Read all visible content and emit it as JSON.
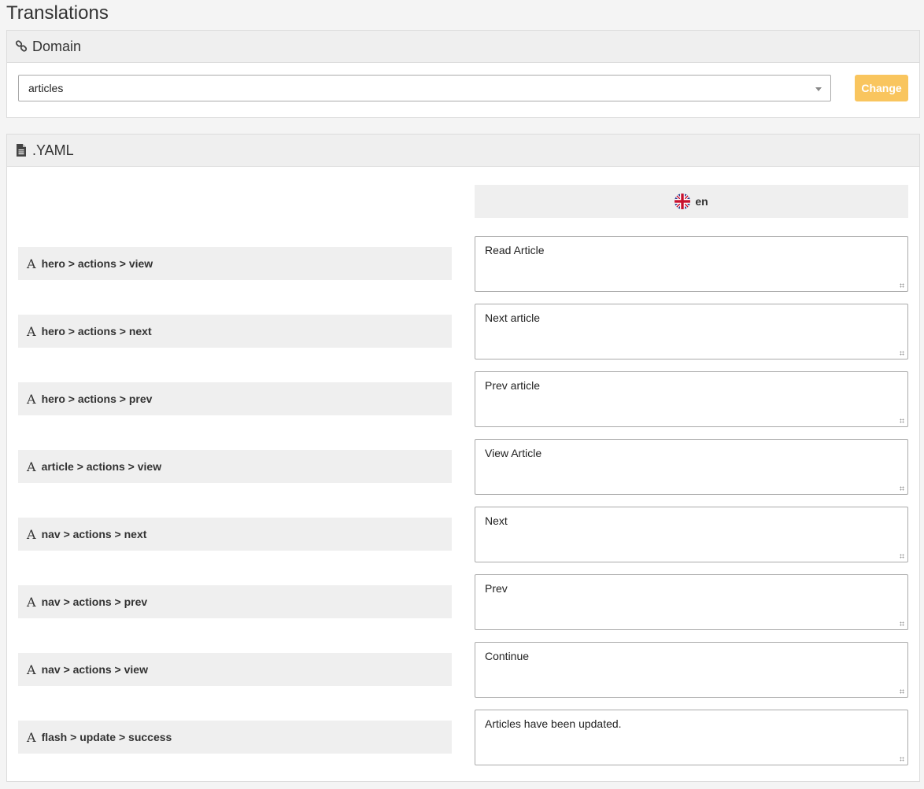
{
  "page": {
    "title": "Translations"
  },
  "domain_panel": {
    "heading": "Domain",
    "icon": "link-icon",
    "select_value": "articles",
    "change_label": "Change"
  },
  "yaml_panel": {
    "heading": ".YAML",
    "icon": "file-text-icon",
    "language": "en",
    "language_flag": "uk-flag-icon",
    "rows": [
      {
        "key": "hero > actions > view",
        "value": "Read Article"
      },
      {
        "key": "hero > actions > next",
        "value": "Next article"
      },
      {
        "key": "hero > actions > prev",
        "value": "Prev article"
      },
      {
        "key": "article > actions > view",
        "value": "View Article"
      },
      {
        "key": "nav > actions > next",
        "value": "Next"
      },
      {
        "key": "nav > actions > prev",
        "value": "Prev"
      },
      {
        "key": "nav > actions > view",
        "value": "Continue"
      },
      {
        "key": "flash > update > success",
        "value": "Articles have been updated."
      }
    ]
  },
  "colors": {
    "accent_button": "#f9c55e",
    "panel_heading_bg": "#efefef",
    "page_bg": "#f4f4f4"
  }
}
